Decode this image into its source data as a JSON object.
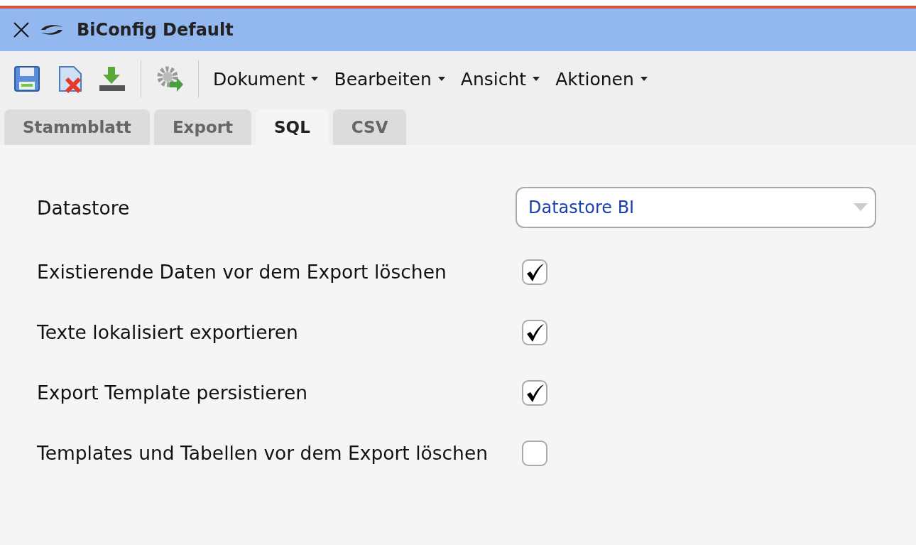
{
  "window": {
    "title": "BiConfig Default"
  },
  "menus": [
    {
      "label": "Dokument"
    },
    {
      "label": "Bearbeiten"
    },
    {
      "label": "Ansicht"
    },
    {
      "label": "Aktionen"
    }
  ],
  "tabs": [
    {
      "label": "Stammblatt",
      "selected": false
    },
    {
      "label": "Export",
      "selected": false
    },
    {
      "label": "SQL",
      "selected": true
    },
    {
      "label": "CSV",
      "selected": false
    }
  ],
  "datastore": {
    "label": "Datastore",
    "value": "Datastore BI"
  },
  "options": [
    {
      "label": "Existierende Daten vor dem Export löschen",
      "checked": true
    },
    {
      "label": "Texte lokalisiert exportieren",
      "checked": true
    },
    {
      "label": "Export Template persistieren",
      "checked": true
    },
    {
      "label": "Templates und Tabellen vor dem Export löschen",
      "checked": false
    }
  ]
}
